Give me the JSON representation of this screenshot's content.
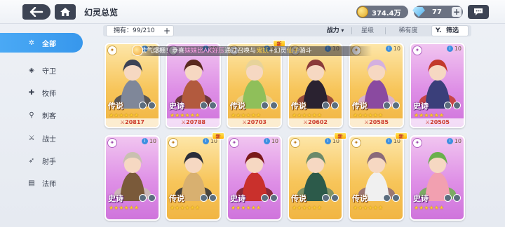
{
  "header": {
    "title": "幻灵总览",
    "gold": "374.4万",
    "gems": "77"
  },
  "filters": {
    "owned_label": "拥有：99/210",
    "sort_power": "战力",
    "sort_star": "星级",
    "sort_rarity": "稀有度",
    "filter_label": "筛选"
  },
  "marquee": {
    "prefix": "欧气爆棚！恭喜",
    "player": "妹妹比AK好压",
    "middle": "通过召唤与",
    "source": "鬼妖",
    "suffix": "+幻灵",
    "hero": "仙子",
    "tail": "骑斗"
  },
  "sidebar": {
    "items": [
      {
        "label": "全部",
        "icon": "star-icon"
      },
      {
        "label": "守卫",
        "icon": "shield-icon"
      },
      {
        "label": "牧师",
        "icon": "heal-icon"
      },
      {
        "label": "刺客",
        "icon": "dagger-icon"
      },
      {
        "label": "战士",
        "icon": "sword-icon"
      },
      {
        "label": "射手",
        "icon": "bow-icon"
      },
      {
        "label": "法师",
        "icon": "book-icon"
      }
    ]
  },
  "cards": [
    {
      "rarity": "传说",
      "level": "10",
      "power": "20817",
      "new": false
    },
    {
      "rarity": "史诗",
      "level": "10",
      "power": "20788",
      "new": false
    },
    {
      "rarity": "传说",
      "level": "10",
      "power": "20703",
      "new": true
    },
    {
      "rarity": "传说",
      "level": "10",
      "power": "20602",
      "new": false
    },
    {
      "rarity": "传说",
      "level": "10",
      "power": "20585",
      "new": false
    },
    {
      "rarity": "史诗",
      "level": "10",
      "power": "20505",
      "new": false
    },
    {
      "rarity": "史诗",
      "level": "10",
      "power": "",
      "new": false
    },
    {
      "rarity": "传说",
      "level": "10",
      "power": "",
      "new": true
    },
    {
      "rarity": "史诗",
      "level": "10",
      "power": "",
      "new": false
    },
    {
      "rarity": "传说",
      "level": "10",
      "power": "",
      "new": true
    },
    {
      "rarity": "传说",
      "level": "10",
      "power": "",
      "new": true
    },
    {
      "rarity": "史诗",
      "level": "10",
      "power": "",
      "new": false
    }
  ],
  "stars": "★★★★★★",
  "power_icon": "⚔",
  "new_label": "新",
  "colors": {
    "accent": "#3797ec",
    "legend": "#f7c55a",
    "epic": "#de8fe6",
    "power_text": "#cc3b2c"
  }
}
